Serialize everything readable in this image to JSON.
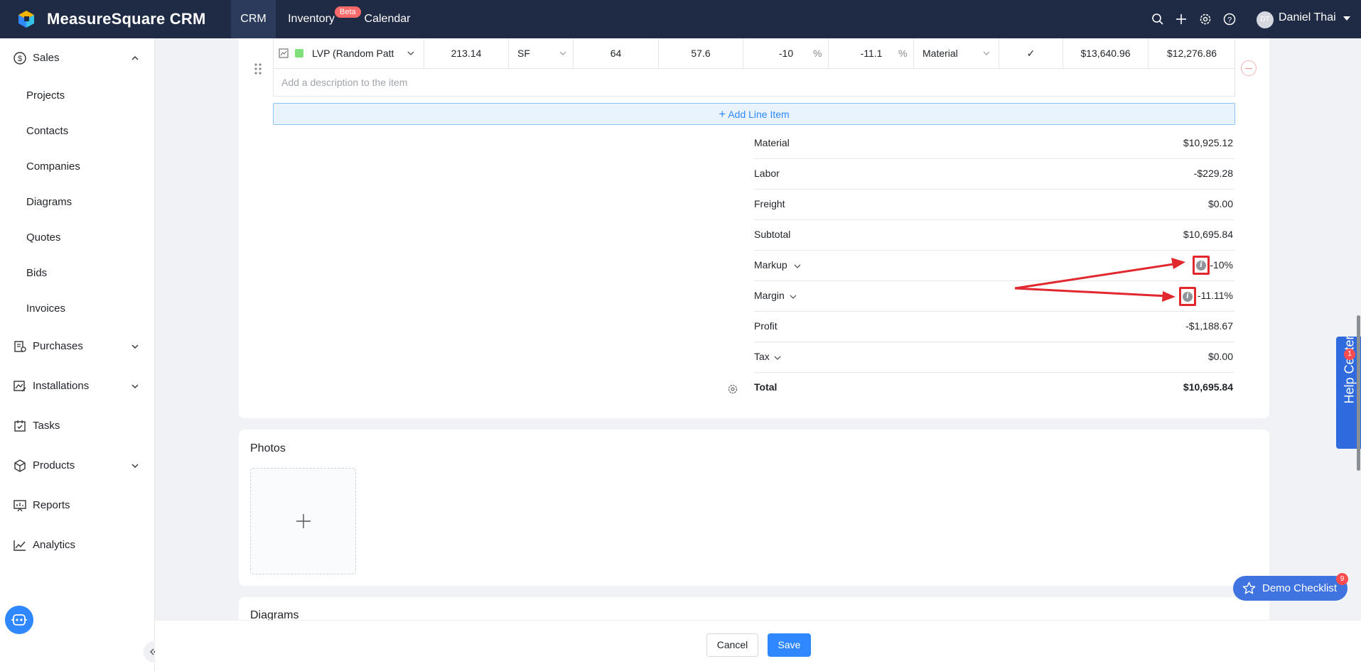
{
  "app": {
    "brand": "MeasureSquare CRM"
  },
  "topnav": {
    "crm": "CRM",
    "inventory": "Inventory",
    "beta_badge": "Beta",
    "calendar": "Calendar"
  },
  "user": {
    "initials": "DT",
    "name": "Daniel Thai"
  },
  "topbar_icons": [
    "search-icon",
    "plus-icon",
    "gear-icon",
    "help-icon"
  ],
  "sidebar": {
    "sales": "Sales",
    "sales_items": [
      "Projects",
      "Contacts",
      "Companies",
      "Diagrams",
      "Quotes",
      "Bids",
      "Invoices"
    ],
    "purchases": "Purchases",
    "installations": "Installations",
    "tasks": "Tasks",
    "products": "Products",
    "reports": "Reports",
    "analytics": "Analytics"
  },
  "line_item": {
    "product": "LVP (Random Patte",
    "quantity": "213.14",
    "unit": "SF",
    "col3": "64",
    "col4": "57.6",
    "markup": "-10",
    "markup_unit": "%",
    "margin": "-11.1",
    "margin_unit": "%",
    "type": "Material",
    "taxable_check": "✓",
    "col_total1": "$13,640.96",
    "col_total2": "$12,276.86",
    "description_placeholder": "Add a description to the item"
  },
  "add_line_label": "Add Line Item",
  "summary": [
    {
      "label": "Material",
      "value": "$10,925.12"
    },
    {
      "label": "Labor",
      "value": "-$229.28"
    },
    {
      "label": "Freight",
      "value": "$0.00"
    },
    {
      "label": "Subtotal",
      "value": "$10,695.84"
    },
    {
      "label": "Markup",
      "value": "-10%"
    },
    {
      "label": "Margin",
      "value": "-11.11%"
    },
    {
      "label": "Profit",
      "value": "-$1,188.67"
    },
    {
      "label": "Tax",
      "value": "$0.00"
    },
    {
      "label": "Total",
      "value": "$10,695.84"
    }
  ],
  "photos": {
    "title": "Photos"
  },
  "diagrams": {
    "title": "Diagrams"
  },
  "footer": {
    "cancel": "Cancel",
    "save": "Save"
  },
  "help_center": {
    "label": "Help Center",
    "badge": "1"
  },
  "demo_checklist": {
    "label": "Demo Checklist",
    "badge": "9"
  },
  "colors": {
    "topbar": "#1f2a44",
    "accent": "#2f88ff",
    "annotation": "#e0282e",
    "material_swatch": "#7ee07a"
  }
}
